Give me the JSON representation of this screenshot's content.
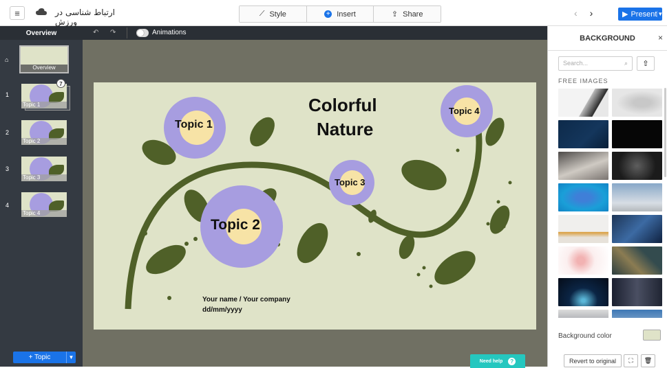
{
  "header": {
    "doc_title": "ارتباط شناسی در ورزش",
    "tabs": [
      {
        "label": "Style",
        "icon": "wand-icon"
      },
      {
        "label": "Insert",
        "icon": "plus-circle-icon"
      },
      {
        "label": "Share",
        "icon": "share-icon"
      }
    ],
    "prev": "‹",
    "next": "›",
    "present_label": "Present"
  },
  "sidebar": {
    "title": "Overview",
    "overview_label": "Overview",
    "items": [
      {
        "num": "1",
        "label": "Topic 1"
      },
      {
        "num": "2",
        "label": "Topic 2"
      },
      {
        "num": "3",
        "label": "Topic 3"
      },
      {
        "num": "4",
        "label": "Topic 4"
      }
    ],
    "stack_count": "7",
    "add_topic": "+ Topic"
  },
  "toolbar": {
    "animations_label": "Animations"
  },
  "slide": {
    "title_line1": "Colorful",
    "title_line2": "Nature",
    "topics": [
      "Topic 1",
      "Topic 2",
      "Topic 3",
      "Topic 4"
    ],
    "footer_name": "Your name / Your company",
    "footer_date": "dd/mm/yyyy"
  },
  "help": {
    "label": "Need help",
    "icon": "?"
  },
  "panel": {
    "title": "BACKGROUND",
    "close": "×",
    "search_placeholder": "Search...",
    "free_images_label": "FREE IMAGES",
    "bg_color_label": "Background color",
    "bg_color": "#dfe3c8",
    "revert_label": "Revert to original"
  },
  "colors": {
    "accent": "#1a73e8",
    "topic_circle": "#a79de0",
    "topic_center": "#f7e3a6",
    "leaf": "#4f6028",
    "help": "#25c7bf"
  }
}
